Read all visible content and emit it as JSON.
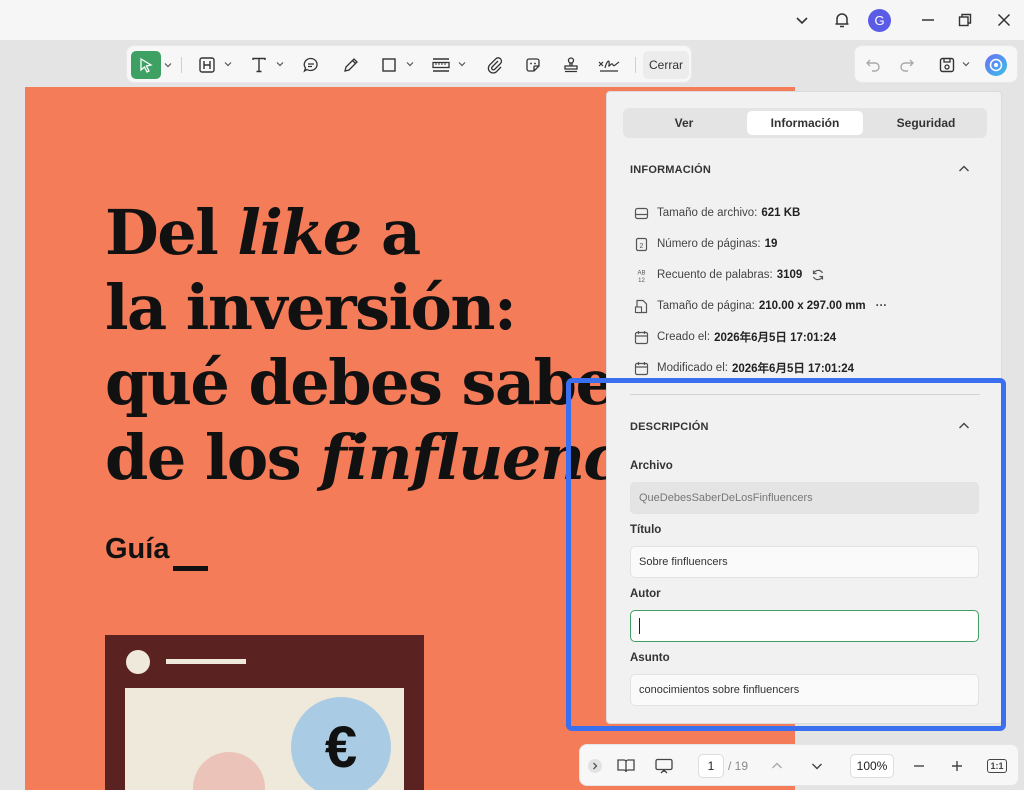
{
  "titlebar": {
    "avatar_letter": "G"
  },
  "toolbar": {
    "close_label": "Cerrar"
  },
  "document": {
    "title_line1_a": "Del ",
    "title_line1_b": "like",
    "title_line1_c": " a",
    "title_line2": "la inversión:",
    "title_line3": "qué debes saber",
    "title_line4_a": "de los ",
    "title_line4_b": "finfluencers",
    "subtitle": "Guía",
    "euro_symbol": "€"
  },
  "panel": {
    "tabs": [
      {
        "label": "Ver"
      },
      {
        "label": "Información"
      },
      {
        "label": "Seguridad"
      }
    ],
    "info_title": "INFORMACIÓN",
    "info": {
      "file_size_label": "Tamaño de archivo:",
      "file_size_value": "621 KB",
      "pages_label": "Número de páginas:",
      "pages_value": "19",
      "words_label": "Recuento de palabras:",
      "words_value": "3109",
      "page_size_label": "Tamaño de página:",
      "page_size_value": "210.00 x 297.00 mm",
      "more": "···",
      "created_label": "Creado el:",
      "created_value": "2026年6月5日 17:01:24",
      "modified_label": "Modificado el:",
      "modified_value": "2026年6月5日 17:01:24"
    },
    "desc_title": "DESCRIPCIÓN",
    "fields": {
      "file_label": "Archivo",
      "file_value": "QueDebesSaberDeLosFinfluencers",
      "title_label": "Título",
      "title_value": "Sobre finfluencers",
      "author_label": "Autor",
      "author_value": "",
      "subject_label": "Asunto",
      "subject_value": "conocimientos sobre finfluencers"
    }
  },
  "bottombar": {
    "current_page": "1",
    "total_pages": "/ 19",
    "zoom": "100%",
    "fit_label": "1:1"
  },
  "colors": {
    "accent_green": "#3ea063",
    "highlight_blue": "#3a6ff0",
    "doc_orange": "#f47c59"
  }
}
